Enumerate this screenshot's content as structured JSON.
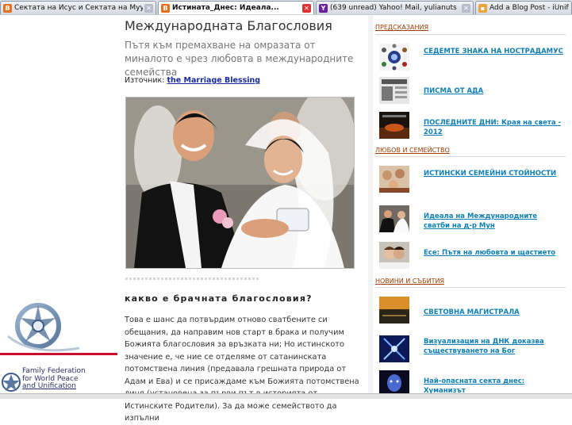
{
  "browser": {
    "tabs": [
      {
        "label": "Сектата на Исус и Сектата на Муу...",
        "icon": "blogger-icon",
        "active": false
      },
      {
        "label": "Истината_Днес: Идеала...",
        "icon": "blogger-icon",
        "active": true
      },
      {
        "label": "(639 unread) Yahoo! Mail, yulianuts",
        "icon": "yahoo-icon",
        "active": false
      },
      {
        "label": "Add a Blog Post - iUnificat",
        "icon": "folder-icon",
        "active": false
      }
    ]
  },
  "post": {
    "title": "Международната Благословия",
    "subtitle": "Пътя към премахване на омразата от миналото е чрез любовта в международните семейства",
    "source_label": "Източник:",
    "source_link": "the Marriage Blessing",
    "heading": "какво е брачната благословия?",
    "body": "Това е шанс да потвърдим отново сватбените си обещания, да направим нов старт в брака и получим Божията благословия за връзката ни; Но истинското значение е, че ние се отделяме от сатанинската потомствена линия (предавала грешната природа от Адам и Ева) и се присаждаме към Божията потомствена линя (установена за първи път в историята от Истинските Родители). За да може семейството да изпълни"
  },
  "sidebar": {
    "sections": [
      {
        "title": "ПРЕДСКАЗАНИЯ",
        "items": [
          {
            "label": "СЕДЕМТЕ ЗНАКА НА НОСТРАДАМУС",
            "thumb": "nostradamus"
          },
          {
            "label": "ПИСМА ОТ АДА",
            "thumb": "letters"
          },
          {
            "label": "ПОСЛЕДНИТЕ ДНИ: Края на света - 2012",
            "thumb": "lastdays"
          }
        ]
      },
      {
        "title": "ЛЮБОВ И СЕМЕЙСТВО",
        "items": [
          {
            "label": "ИСТИНСКИ СЕМЕЙНИ СТОЙНОСТИ",
            "thumb": "family"
          },
          {
            "label": "Идеала на Международните сватби на д-р Мун",
            "thumb": "wedding"
          },
          {
            "label": "Есе: Пътя на любовта и щастието",
            "thumb": "couple"
          }
        ]
      },
      {
        "title": "НОВИНИ И СЪБИТИЯ",
        "items": [
          {
            "label": "СВЕТОВНА МАГИСТРАЛА",
            "thumb": "highway"
          },
          {
            "label": "Визуализация на ДНК доказва съществуването на Бог",
            "thumb": "dna"
          },
          {
            "label": "Най-опасната секта днес: Хуманизът",
            "thumb": "sect"
          }
        ]
      }
    ]
  },
  "logo": {
    "text_lines": [
      "Family Federation",
      "for World Peace",
      "and Unification"
    ]
  }
}
